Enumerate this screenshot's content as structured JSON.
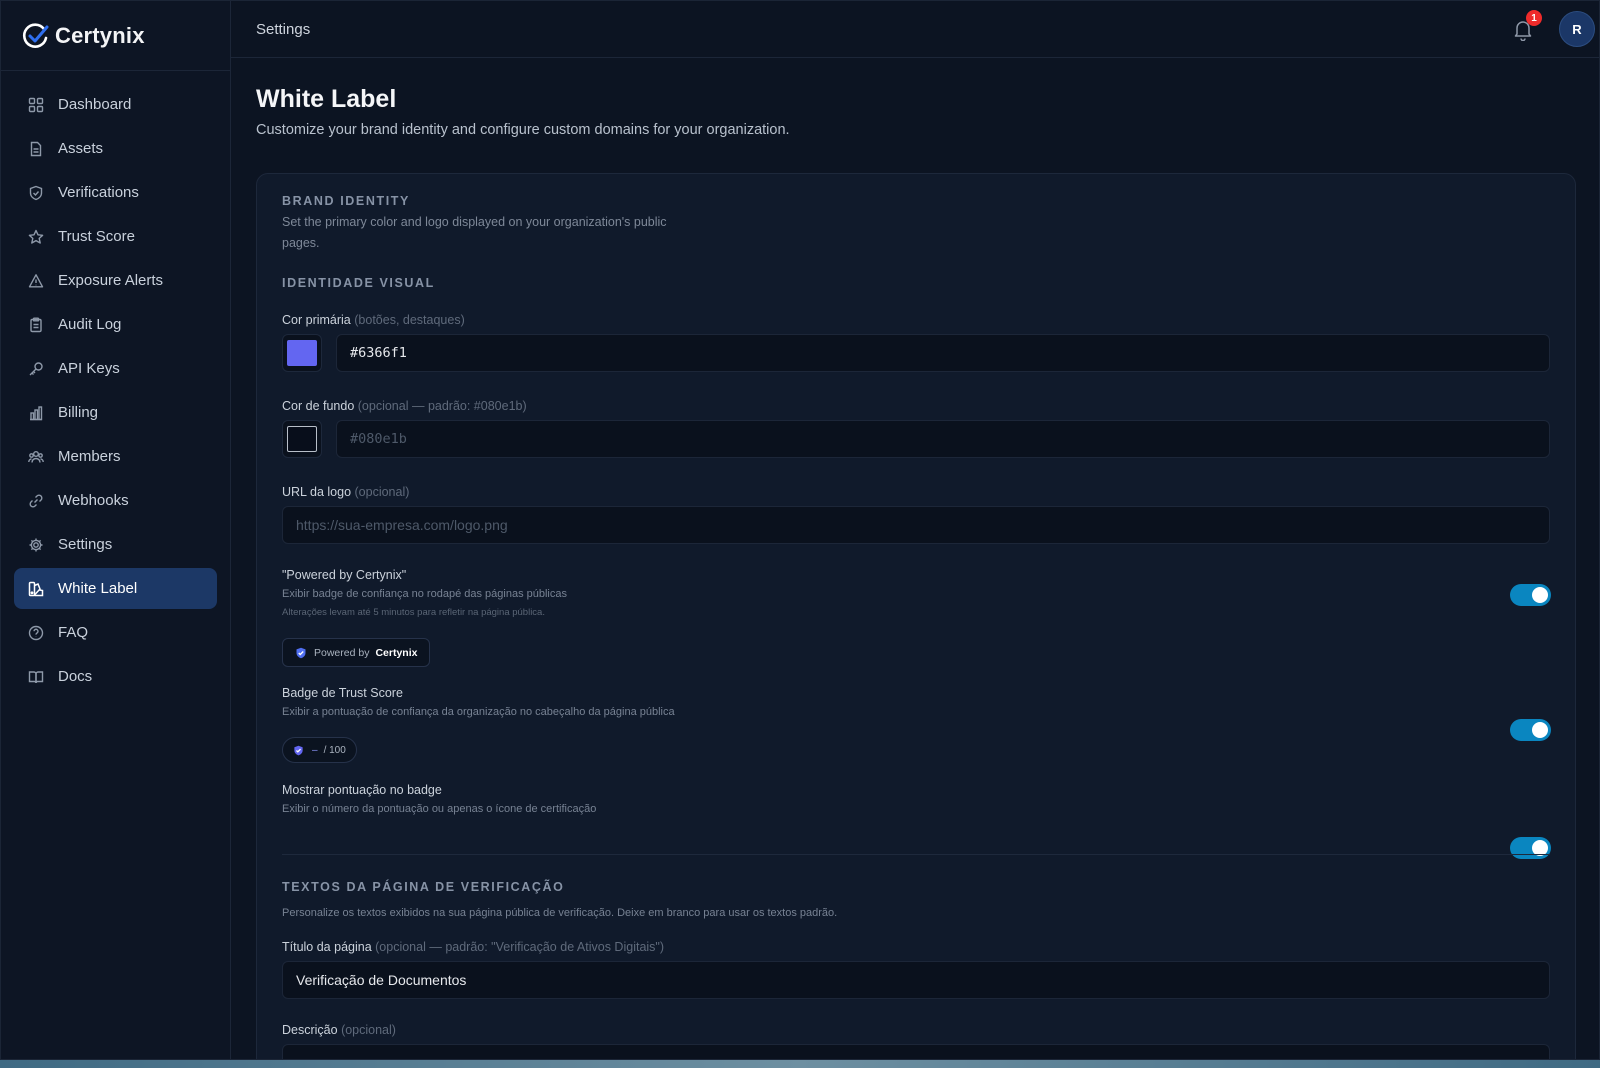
{
  "brand": {
    "name": "Certynix"
  },
  "nav": [
    {
      "label": "Dashboard",
      "icon": "grid-icon"
    },
    {
      "label": "Assets",
      "icon": "file-icon"
    },
    {
      "label": "Verifications",
      "icon": "shield-check-icon"
    },
    {
      "label": "Trust Score",
      "icon": "star-icon"
    },
    {
      "label": "Exposure Alerts",
      "icon": "alert-triangle-icon"
    },
    {
      "label": "Audit Log",
      "icon": "clipboard-icon"
    },
    {
      "label": "API Keys",
      "icon": "key-icon"
    },
    {
      "label": "Billing",
      "icon": "bar-chart-icon"
    },
    {
      "label": "Members",
      "icon": "users-icon"
    },
    {
      "label": "Webhooks",
      "icon": "link-icon"
    },
    {
      "label": "Settings",
      "icon": "gear-icon"
    },
    {
      "label": "White Label",
      "icon": "palette-icon",
      "active": true
    },
    {
      "label": "FAQ",
      "icon": "help-circle-icon"
    },
    {
      "label": "Docs",
      "icon": "book-icon"
    }
  ],
  "topbar": {
    "title": "Settings",
    "notifications": "1",
    "avatar": "R"
  },
  "page": {
    "title": "White Label",
    "subtitle": "Customize your brand identity and configure custom domains for your organization."
  },
  "brand_identity": {
    "title": "BRAND IDENTITY",
    "description_line1": "Set the primary color and logo displayed on your organization's public",
    "description_line2": "pages."
  },
  "visual": {
    "title": "IDENTIDADE VISUAL",
    "primary_label": "Cor primária",
    "primary_hint": "(botões, destaques)",
    "primary_value": "#6366f1",
    "primary_color": "#6366f1",
    "bg_label": "Cor de fundo",
    "bg_hint": "(opcional — padrão: #080e1b)",
    "bg_placeholder": "#080e1b",
    "bg_color": "#080e1b",
    "logo_label": "URL da logo",
    "logo_hint": "(opcional)",
    "logo_placeholder": "https://sua-empresa.com/logo.png"
  },
  "powered": {
    "title": "\"Powered by Certynix\"",
    "desc": "Exibir badge de confiança no rodapé das páginas públicas",
    "note": "Alterações levam até 5 minutos para refletir na página pública.",
    "badge_prefix": "Powered by",
    "badge_brand": "Certynix",
    "enabled": true
  },
  "trust_badge": {
    "title": "Badge de Trust Score",
    "desc": "Exibir a pontuação de confiança da organização no cabeçalho da página pública",
    "badge_value": "–",
    "badge_suffix": "/ 100",
    "enabled": true
  },
  "show_score": {
    "title": "Mostrar pontuação no badge",
    "desc": "Exibir o número da pontuação ou apenas o ícone de certificação",
    "enabled": true
  },
  "texts": {
    "title": "TEXTOS DA PÁGINA DE VERIFICAÇÃO",
    "desc": "Personalize os textos exibidos na sua página pública de verificação. Deixe em branco para usar os textos padrão.",
    "page_title_label": "Título da página",
    "page_title_hint": "(opcional — padrão: \"Verificação de Ativos Digitais\")",
    "page_title_value": "Verificação de Documentos",
    "description_label": "Descrição",
    "description_hint": "(opcional)"
  }
}
